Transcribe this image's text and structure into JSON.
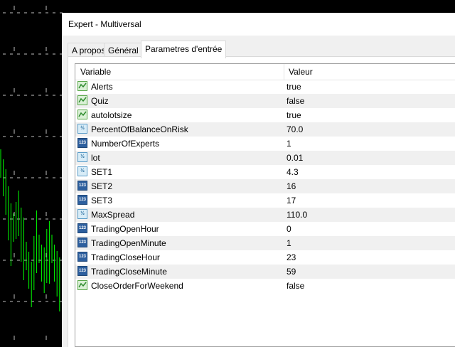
{
  "window": {
    "title": "Expert - Multiversal"
  },
  "tabs": [
    {
      "label": "A propos",
      "active": false
    },
    {
      "label": "Général",
      "active": false
    },
    {
      "label": "Parametres d'entrée",
      "active": true
    }
  ],
  "table": {
    "columns": [
      "Variable",
      "Valeur"
    ],
    "rows": [
      {
        "name": "Alerts",
        "value": "true",
        "type": "bool-icon"
      },
      {
        "name": "Quiz",
        "value": "false",
        "type": "bool-icon"
      },
      {
        "name": "autolotsize",
        "value": "true",
        "type": "bool-icon"
      },
      {
        "name": "PercentOfBalanceOnRisk",
        "value": "70.0",
        "type": "double-icon"
      },
      {
        "name": "NumberOfExperts",
        "value": "1",
        "type": "int-icon"
      },
      {
        "name": "lot",
        "value": "0.01",
        "type": "double-icon"
      },
      {
        "name": "SET1",
        "value": "4.3",
        "type": "double-icon"
      },
      {
        "name": "SET2",
        "value": "16",
        "type": "int-icon"
      },
      {
        "name": "SET3",
        "value": "17",
        "type": "int-icon"
      },
      {
        "name": "MaxSpread",
        "value": "110.0",
        "type": "double-icon"
      },
      {
        "name": "TradingOpenHour",
        "value": "0",
        "type": "int-icon"
      },
      {
        "name": "TradingOpenMinute",
        "value": "1",
        "type": "int-icon"
      },
      {
        "name": "TradingCloseHour",
        "value": "23",
        "type": "int-icon"
      },
      {
        "name": "TradingCloseMinute",
        "value": "59",
        "type": "int-icon"
      },
      {
        "name": "CloseOrderForWeekend",
        "value": "false",
        "type": "bool-icon"
      }
    ]
  },
  "icon_text": {
    "double": "½",
    "int": "123"
  },
  "colors": {
    "chart_background": "#000000",
    "candles": "#00ff00",
    "grid": "#c0c0c0"
  }
}
